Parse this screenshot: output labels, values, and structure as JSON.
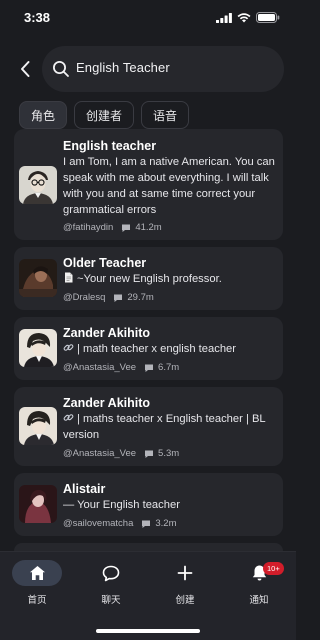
{
  "status_bar": {
    "time": "3:38"
  },
  "search": {
    "query": "English Teacher"
  },
  "filter_tabs": [
    {
      "label": "角色",
      "active": true
    },
    {
      "label": "创建者",
      "active": false
    },
    {
      "label": "语音",
      "active": false
    }
  ],
  "results": [
    {
      "name": "English teacher",
      "description": "I am Tom, I am a native American. You can speak with me about everything. I will talk with you and at same time correct your grammatical errors",
      "creator": "@fatihaydin",
      "chats": "41.2m"
    },
    {
      "name": "Older Teacher",
      "prefix_icon": "document-icon",
      "description": "~Your new English professor.",
      "creator": "@Dralesq",
      "chats": "29.7m"
    },
    {
      "name": "Zander Akihito",
      "prefix_icon": "link-icon",
      "description": "| math teacher x english teacher",
      "creator": "@Anastasia_Vee",
      "chats": "6.7m"
    },
    {
      "name": "Zander Akihito",
      "prefix_icon": "link-icon",
      "description": "| maths teacher x English teacher | BL version",
      "creator": "@Anastasia_Vee",
      "chats": "5.3m"
    },
    {
      "name": "Alistair",
      "description": "— Your English teacher",
      "creator": "@sailovematcha",
      "chats": "3.2m"
    }
  ],
  "bottom_nav": [
    {
      "label": "首页",
      "icon": "home-icon",
      "active": true
    },
    {
      "label": "聊天",
      "icon": "chat-bubble-icon",
      "active": false
    },
    {
      "label": "创建",
      "icon": "plus-icon",
      "active": false
    },
    {
      "label": "通知",
      "icon": "bell-icon",
      "active": false,
      "badge": "10+"
    }
  ],
  "colors": {
    "background": "#1b1c20",
    "card": "#26272c",
    "badge": "#d21d2a",
    "active_nav": "#3a4150"
  }
}
